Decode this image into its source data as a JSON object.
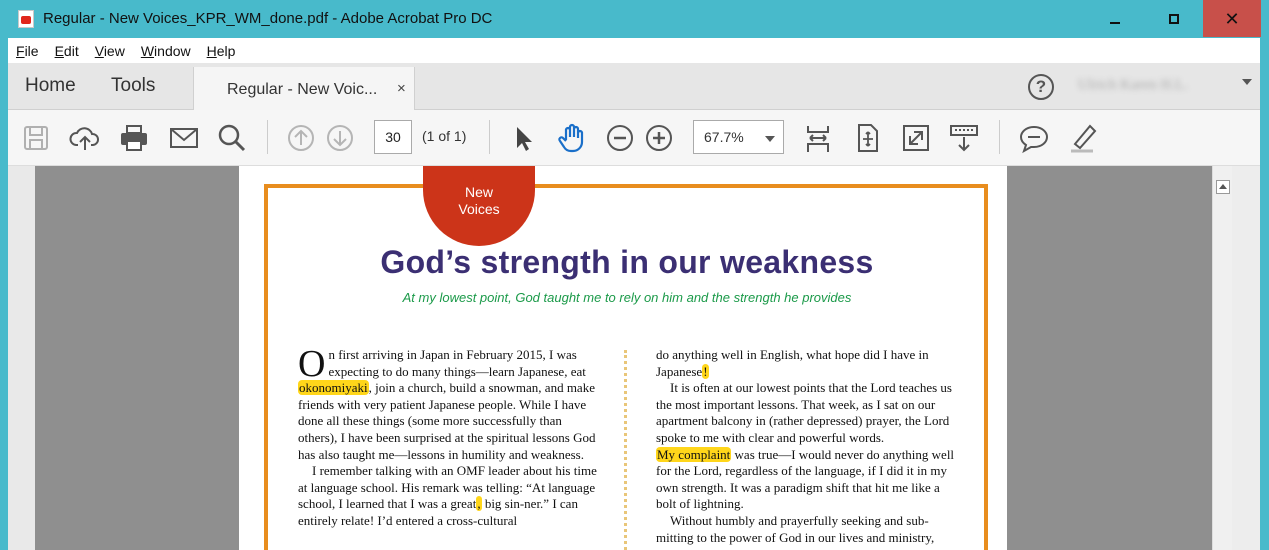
{
  "window": {
    "title": "Regular - New Voices_KPR_WM_done.pdf - Adobe Acrobat Pro DC"
  },
  "menu": [
    "File",
    "Edit",
    "View",
    "Window",
    "Help"
  ],
  "tabs": {
    "home": "Home",
    "tools": "Tools",
    "document": "Regular - New Voic...",
    "close": "×"
  },
  "account": {
    "help": "?",
    "user_name": "Ulrich Karen H.L."
  },
  "toolbar": {
    "page_number": "30",
    "page_of": "(1 of 1)",
    "zoom": "67.7%"
  },
  "document": {
    "badge_line1": "New",
    "badge_line2": "Voices",
    "headline": "God’s strength in our weakness",
    "subhead": "At my lowest point, God taught me to rely on him and the strength he provides",
    "left_column": {
      "dropcap": "O",
      "p1_a": "n first arriving in Japan in February 2015, I was expecting to do many things—learn Japanese, eat ",
      "p1_hl": "okonomiyaki",
      "p1_b": ", join a church, build a snowman, and make friends with very patient Japanese people. While I have done all these things (some more successfully than others), I have been surprised at the spiritual lessons God has also taught me—lessons in humility and weakness.",
      "p2_a": "I remember talking with an OMF leader about his time at language school. His remark was telling: “At language school, I learned that I was a great",
      "p2_hl": ",",
      "p2_b": " big sin-ner.” I can entirely relate! I’d entered a cross-cultural"
    },
    "right_column": {
      "p1_a": "do anything well in English, what hope did I have in Japanese",
      "p1_hl": "!",
      "p2": "It is often at our lowest points that the Lord teaches us the most important lessons. That week, as I sat on our apartment balcony in (rather depressed) prayer, the Lord spoke to me with clear and powerful words.",
      "p3_hl": "My complaint",
      "p3_b": " was true—I would never do anything well for the Lord, regardless of the language, if I did it in my own strength. It was a paradigm shift that hit me like a bolt of lightning.",
      "p4": "Without humbly and prayerfully seeking and sub-mitting to the power of God in our lives and ministry,"
    }
  },
  "colors": {
    "titlebar": "#48bacb",
    "close_button": "#c8504a",
    "frame": "#e88d1e",
    "badge": "#cc3419",
    "headline": "#3b2f73",
    "subhead": "#1b9a49",
    "highlight": "#ffd61a"
  }
}
